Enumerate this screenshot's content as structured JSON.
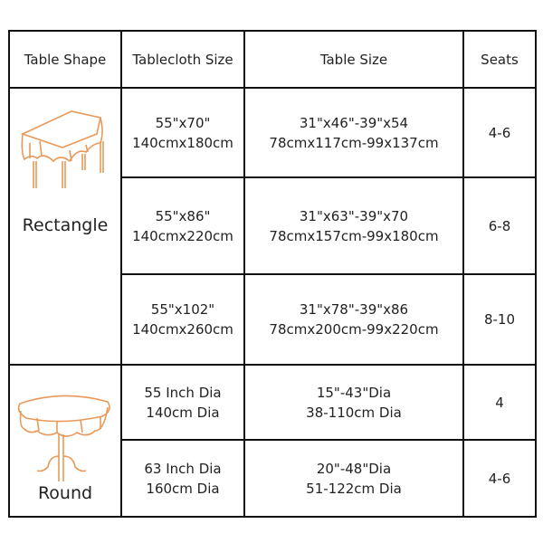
{
  "headers": [
    "Table Shape",
    "Tablecloth Size",
    "Table Size",
    "Seats"
  ],
  "accent_color": "#e8995a",
  "groups": [
    {
      "shape": "Rectangle",
      "icon": "rectangle-table-icon",
      "rows": [
        {
          "cloth": [
            "55\"x70\"",
            "140cmx180cm"
          ],
          "table": [
            "31\"x46\"-39\"x54",
            "78cmx117cm-99x137cm"
          ],
          "seats": "4-6"
        },
        {
          "cloth": [
            "55\"x86\"",
            "140cmx220cm"
          ],
          "table": [
            "31\"x63\"-39\"x70",
            "78cmx157cm-99x180cm"
          ],
          "seats": "6-8"
        },
        {
          "cloth": [
            "55\"x102\"",
            "140cmx260cm"
          ],
          "table": [
            "31\"x78\"-39\"x86",
            "78cmx200cm-99x220cm"
          ],
          "seats": "8-10"
        }
      ]
    },
    {
      "shape": "Round",
      "icon": "round-table-icon",
      "rows": [
        {
          "cloth": [
            "55 Inch Dia",
            "140cm Dia"
          ],
          "table": [
            "15\"-43\"Dia",
            "38-110cm Dia"
          ],
          "seats": "4"
        },
        {
          "cloth": [
            "63 Inch Dia",
            "160cm Dia"
          ],
          "table": [
            "20\"-48\"Dia",
            "51-122cm Dia"
          ],
          "seats": "4-6"
        }
      ]
    }
  ]
}
